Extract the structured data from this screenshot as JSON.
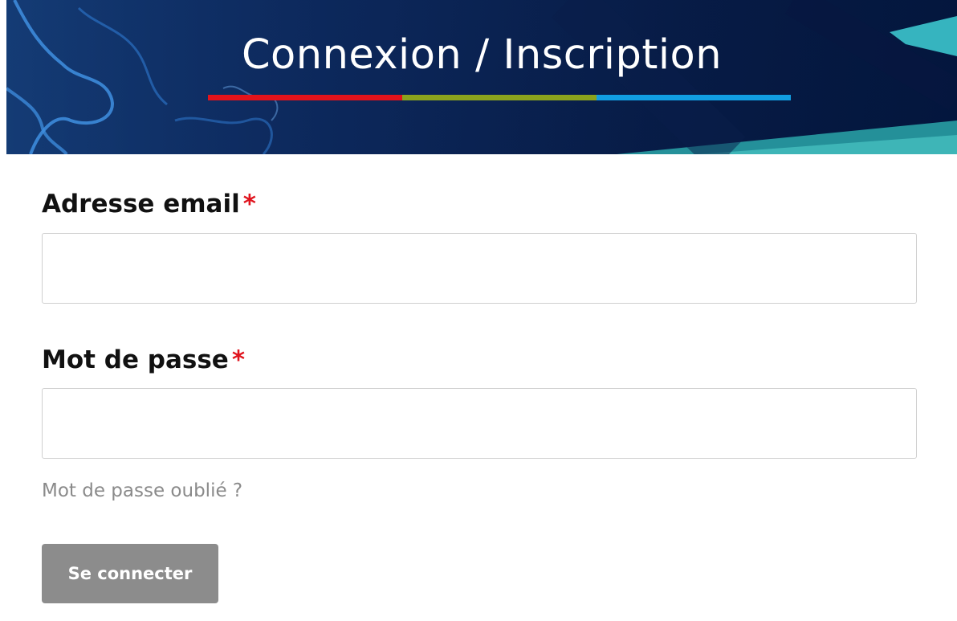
{
  "banner": {
    "title": "Connexion / Inscription",
    "rule_colors": [
      "#e3131b",
      "#8ba31d",
      "#119ee2"
    ],
    "background_color": "#0b2352"
  },
  "form": {
    "email": {
      "label": "Adresse email",
      "required_mark": "*",
      "value": "",
      "placeholder": ""
    },
    "password": {
      "label": "Mot de passe",
      "required_mark": "*",
      "value": "",
      "placeholder": ""
    },
    "forgot_password_link": "Mot de passe oublié ?",
    "submit_label": "Se connecter"
  },
  "colors": {
    "required_star": "#e0141e",
    "link": "#8a8a8a",
    "button_bg": "#8c8c8c",
    "button_text": "#ffffff",
    "input_border": "#cfcfcf"
  }
}
